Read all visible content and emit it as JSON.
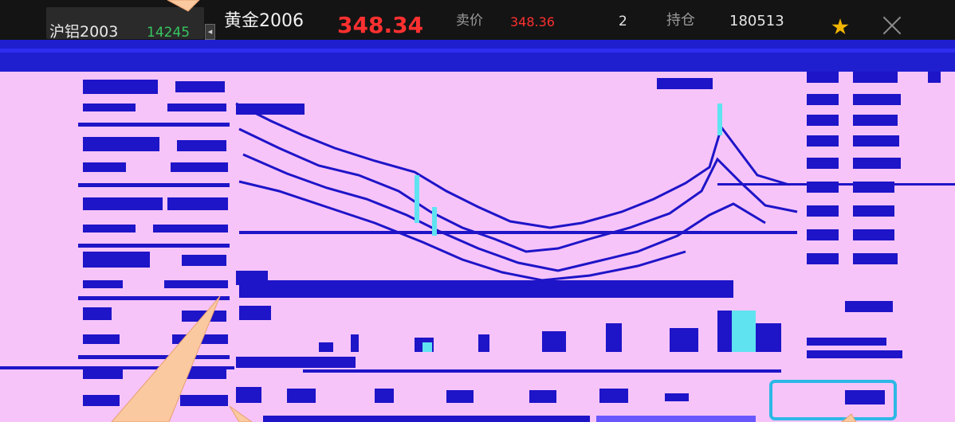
{
  "colors": {
    "up": "#38c460",
    "price": "#ff3030",
    "canvas": "#f6c4f8",
    "noise": "#1e14c8",
    "highlight": "#2db8e6",
    "accent": "#f1b400"
  },
  "previous_instrument": {
    "name": "沪铝2003",
    "price": "14245"
  },
  "instrument": {
    "name": "黄金2006",
    "last_price": "348.34"
  },
  "quote": {
    "ask_label": "卖价",
    "ask_price": "348.36",
    "ask_qty": "2",
    "open_interest_label": "持仓",
    "open_interest": "180513"
  },
  "icons": {
    "prev": "chevron-left-icon",
    "favorite": "star-icon",
    "close": "close-icon"
  }
}
